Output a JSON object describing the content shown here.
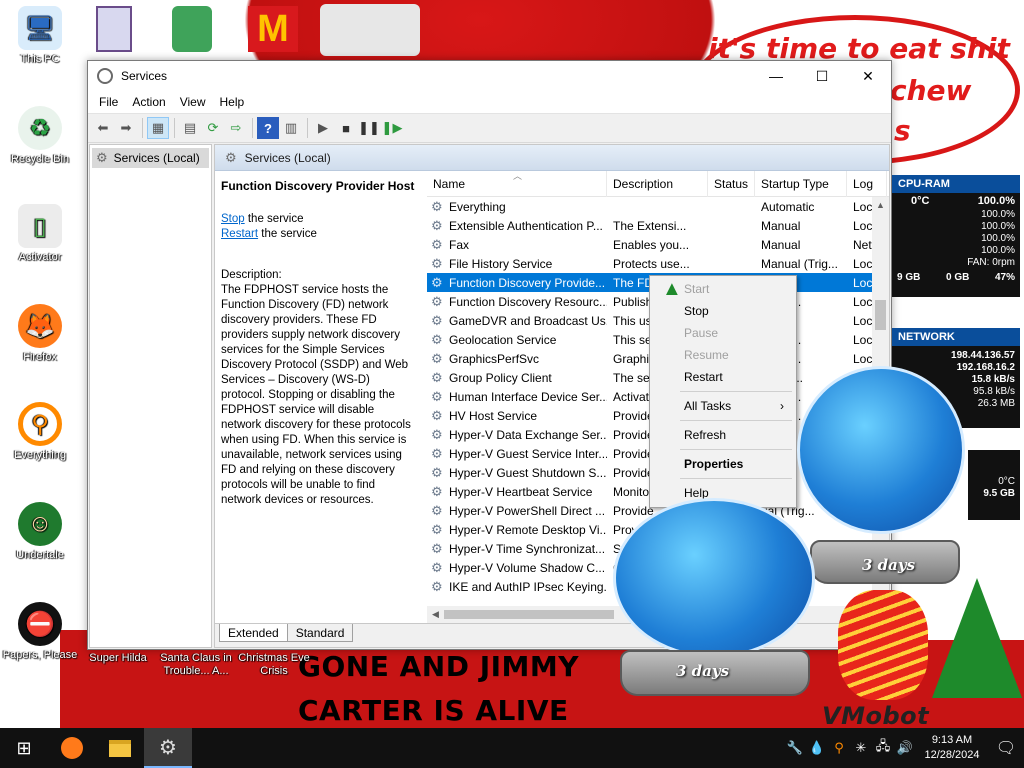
{
  "desktop": {
    "icons": [
      {
        "label": "This PC",
        "glyph": "🖥"
      },
      {
        "label": "Recycle Bin",
        "glyph": "♻"
      },
      {
        "label": "Activator",
        "glyph": "▯"
      },
      {
        "label": "Firefox",
        "glyph": "🦊"
      },
      {
        "label": "Everything",
        "glyph": "⚲"
      },
      {
        "label": "Undertale",
        "glyph": "☺"
      },
      {
        "label": "Papers, Please",
        "glyph": "⛔"
      },
      {
        "label": "Super Hilda",
        "glyph": ""
      },
      {
        "label": "Santa Claus in Trouble... A...",
        "glyph": ""
      },
      {
        "label": "Christmas Eve Crisis",
        "glyph": ""
      }
    ],
    "bubble_line1": "it's time to eat shit",
    "bubble_line2": "chew",
    "bubble_line3": "s",
    "banner_line1": "GONE AND JIMMY",
    "banner_line2": "CARTER IS ALIVE",
    "corner_text": "VMobot"
  },
  "window": {
    "title": "Services",
    "caption": {
      "minimize": "—",
      "maximize": "☐",
      "close": "✕"
    },
    "menu": [
      "File",
      "Action",
      "View",
      "Help"
    ],
    "tree_item": "Services (Local)",
    "panel_header": "Services (Local)",
    "detail": {
      "service_title": "Function Discovery Provider Host",
      "stop_link": "Stop",
      "stop_rest": " the service",
      "restart_link": "Restart",
      "restart_rest": " the service",
      "description_label": "Description:",
      "description": "The FDPHOST service hosts the Function Discovery (FD) network discovery providers. These FD providers supply network discovery services for the Simple Services Discovery Protocol (SSDP) and Web Services – Discovery (WS-D) protocol. Stopping or disabling the FDPHOST service will disable network discovery for these protocols when using FD. When this service is unavailable, network services using FD and relying on these discovery protocols will be unable to find network devices or resources."
    },
    "columns": {
      "name": "Name",
      "description": "Description",
      "status": "Status",
      "startup": "Startup Type",
      "logon": "Log"
    },
    "services": [
      {
        "name": "Everything",
        "description": "",
        "status": "",
        "startup": "Automatic",
        "logon": "Loc"
      },
      {
        "name": "Extensible Authentication P...",
        "description": "The Extensi...",
        "status": "",
        "startup": "Manual",
        "logon": "Loc"
      },
      {
        "name": "Fax",
        "description": "Enables you...",
        "status": "",
        "startup": "Manual",
        "logon": "Net"
      },
      {
        "name": "File History Service",
        "description": "Protects use...",
        "status": "",
        "startup": "Manual (Trig...",
        "logon": "Loc"
      },
      {
        "name": "Function Discovery Provide...",
        "description": "The FD",
        "status": "",
        "startup": "l",
        "logon": "Loc"
      },
      {
        "name": "Function Discovery Resourc...",
        "description": "Publish",
        "status": "",
        "startup": "l (Trig...",
        "logon": "Loc"
      },
      {
        "name": "GameDVR and Broadcast Us...",
        "description": "This us",
        "status": "",
        "startup": "l",
        "logon": "Loc"
      },
      {
        "name": "Geolocation Service",
        "description": "This se",
        "status": "",
        "startup": "l (Trig...",
        "logon": "Loc"
      },
      {
        "name": "GraphicsPerfSvc",
        "description": "Graphi",
        "status": "",
        "startup": "l (Trig...",
        "logon": "Loc"
      },
      {
        "name": "Group Policy Client",
        "description": "The se",
        "status": "",
        "startup": "atic (T...",
        "logon": "Loc"
      },
      {
        "name": "Human Interface Device Ser...",
        "description": "Activat",
        "status": "",
        "startup": "l (Trig...",
        "logon": "Loc"
      },
      {
        "name": "HV Host Service",
        "description": "Provide",
        "status": "",
        "startup": "l (Trig...",
        "logon": "Loc"
      },
      {
        "name": "Hyper-V Data Exchange Ser...",
        "description": "Provide",
        "status": "",
        "startup": "",
        "logon": ""
      },
      {
        "name": "Hyper-V Guest Service Inter...",
        "description": "Provide",
        "status": "",
        "startup": "",
        "logon": ""
      },
      {
        "name": "Hyper-V Guest Shutdown S...",
        "description": "Provide",
        "status": "",
        "startup": "",
        "logon": ""
      },
      {
        "name": "Hyper-V Heartbeat Service",
        "description": "Monito",
        "status": "",
        "startup": "",
        "logon": ""
      },
      {
        "name": "Hyper-V PowerShell Direct ...",
        "description": "Provide",
        "status": "",
        "startup": "ual (Trig...",
        "logon": ""
      },
      {
        "name": "Hyper-V Remote Desktop Vi...",
        "description": "Prov",
        "status": "",
        "startup": "",
        "logon": ""
      },
      {
        "name": "Hyper-V Time Synchronizat...",
        "description": "Sy",
        "status": "",
        "startup": "Trig",
        "logon": ""
      },
      {
        "name": "Hyper-V Volume Shadow C...",
        "description": "C",
        "status": "",
        "startup": "",
        "logon": ""
      },
      {
        "name": "IKE and AuthIP IPsec Keying...",
        "description": "",
        "status": "",
        "startup": "",
        "logon": ""
      }
    ],
    "tabs": [
      "Extended",
      "Standard"
    ]
  },
  "context_menu": {
    "start": "Start",
    "stop": "Stop",
    "pause": "Pause",
    "resume": "Resume",
    "restart": "Restart",
    "all_tasks": "All Tasks",
    "all_tasks_arrow": "›",
    "refresh": "Refresh",
    "properties": "Properties",
    "help": "Help"
  },
  "gadgets": {
    "cpu_ram": {
      "title": "CPU-RAM",
      "temp": "0°C",
      "lines": [
        "100.0%",
        "100.0%",
        "100.0%",
        "100.0%",
        "100.0%",
        "FAN: 0rpm"
      ],
      "mem_left": "9 GB",
      "mem_mid": "0 GB",
      "mem_pct": "47%"
    },
    "network": {
      "title": "NETWORK",
      "lines": [
        "198.44.136.57",
        "192.168.16.2",
        "15.8 kB/s",
        "95.8 kB/s",
        "26.3 MB"
      ]
    },
    "disk": {
      "lines": [
        "0°C",
        "9.5 GB"
      ]
    }
  },
  "globes": {
    "label_small": "3 days",
    "label_large": "3 days"
  },
  "taskbar": {
    "start_glyph": "⊞",
    "apps": [
      "firefox",
      "file-explorer",
      "services"
    ],
    "tray_icons": [
      "🔧",
      "💧",
      "⚲",
      "✳",
      "🖧",
      "🔊"
    ],
    "time": "9:13 AM",
    "date": "12/28/2024",
    "notification_glyph": "🗨"
  }
}
